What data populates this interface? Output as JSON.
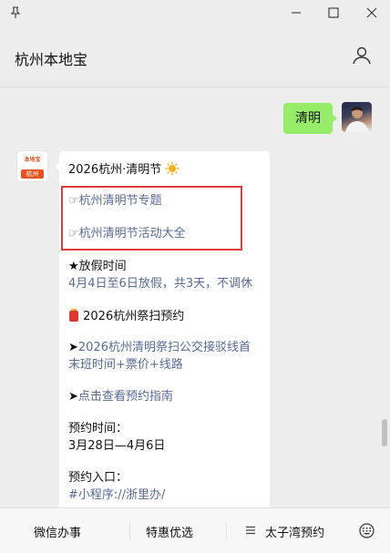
{
  "window": {
    "pin_icon": "pin-icon",
    "minimize_icon": "minimize-icon",
    "maximize_icon": "maximize-icon",
    "close_icon": "close-icon"
  },
  "header": {
    "title": "杭州本地宝",
    "profile_icon": "user-icon"
  },
  "messages": {
    "sent": {
      "text": "清明"
    },
    "bot": {
      "logo_top": "本地宝",
      "logo_city": "杭州",
      "title": "2026杭州·清明节",
      "links": [
        "☞杭州清明节专题",
        "☞杭州清明节活动大全"
      ],
      "holiday_head": "★放假时间",
      "holiday_text": "4月4日至6日放假，共3天，不调休",
      "section_title": "2026杭州祭扫预约",
      "route_arrow": "➤",
      "route_line1": "2026杭州清明祭扫公交接驳线首",
      "route_line2": "末班时间+票价+线路",
      "guide_arrow": "➤",
      "guide_text": "点击查看预约指南",
      "time_label": "预约时间：",
      "time_value": "3月28日—4月6日",
      "entry_label": "预约入口：",
      "entry_value": "#小程序://浙里办/"
    }
  },
  "bottom_menu": {
    "item1": "微信办事",
    "item2": "特惠优选",
    "item3": "太子湾预约"
  }
}
